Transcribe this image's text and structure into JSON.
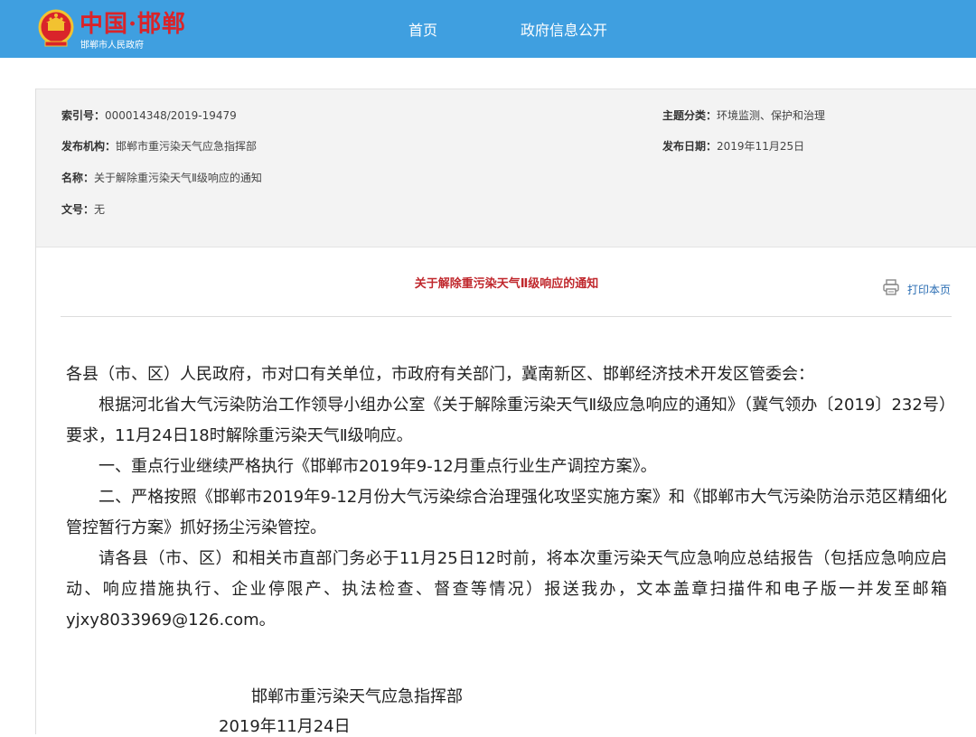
{
  "header": {
    "logo_title": "中国·邯郸",
    "logo_subtitle": "邯郸市人民政府",
    "nav": [
      "首页",
      "政府信息公开"
    ],
    "accent_color": "#3f9fe0",
    "emblem_icon": "national-emblem-icon"
  },
  "meta": {
    "index_label": "索引号：",
    "index_value": "000014348/2019-19479",
    "topic_label": "主题分类：",
    "topic_value": "环境监测、保护和治理",
    "org_label": "发布机构：",
    "org_value": "邯郸市重污染天气应急指挥部",
    "date_label": "发布日期：",
    "date_value": "2019年11月25日",
    "name_label": "名称：",
    "name_value": "关于解除重污染天气Ⅱ级响应的通知",
    "docno_label": "文号：",
    "docno_value": "无"
  },
  "doc": {
    "title": "关于解除重污染天气Ⅱ级响应的通知",
    "title_color": "#c0282d",
    "print_label": "打印本页",
    "print_icon": "printer-icon",
    "paragraphs": [
      "各县（市、区）人民政府，市对口有关单位，市政府有关部门，冀南新区、邯郸经济技术开发区管委会：",
      "根据河北省大气污染防治工作领导小组办公室《关于解除重污染天气Ⅱ级应急响应的通知》（冀气领办〔2019〕232号）要求，11月24日18时解除重污染天气Ⅱ级响应。",
      "一、重点行业继续严格执行《邯郸市2019年9-12月重点行业生产调控方案》。",
      "二、严格按照《邯郸市2019年9-12月份大气污染综合治理强化攻坚实施方案》和《邯郸市大气污染防治示范区精细化管控暂行方案》抓好扬尘污染管控。",
      "请各县（市、区）和相关市直部门务必于11月25日12时前，将本次重污染天气应急响应总结报告（包括应急响应启动、响应措施执行、企业停限产、执法检查、督查等情况）报送我办，文本盖章扫描件和电子版一并发至邮箱yjxy8033969@126.com。"
    ],
    "signature_org": "邯郸市重污染天气应急指挥部",
    "signature_date": "2019年11月24日"
  }
}
